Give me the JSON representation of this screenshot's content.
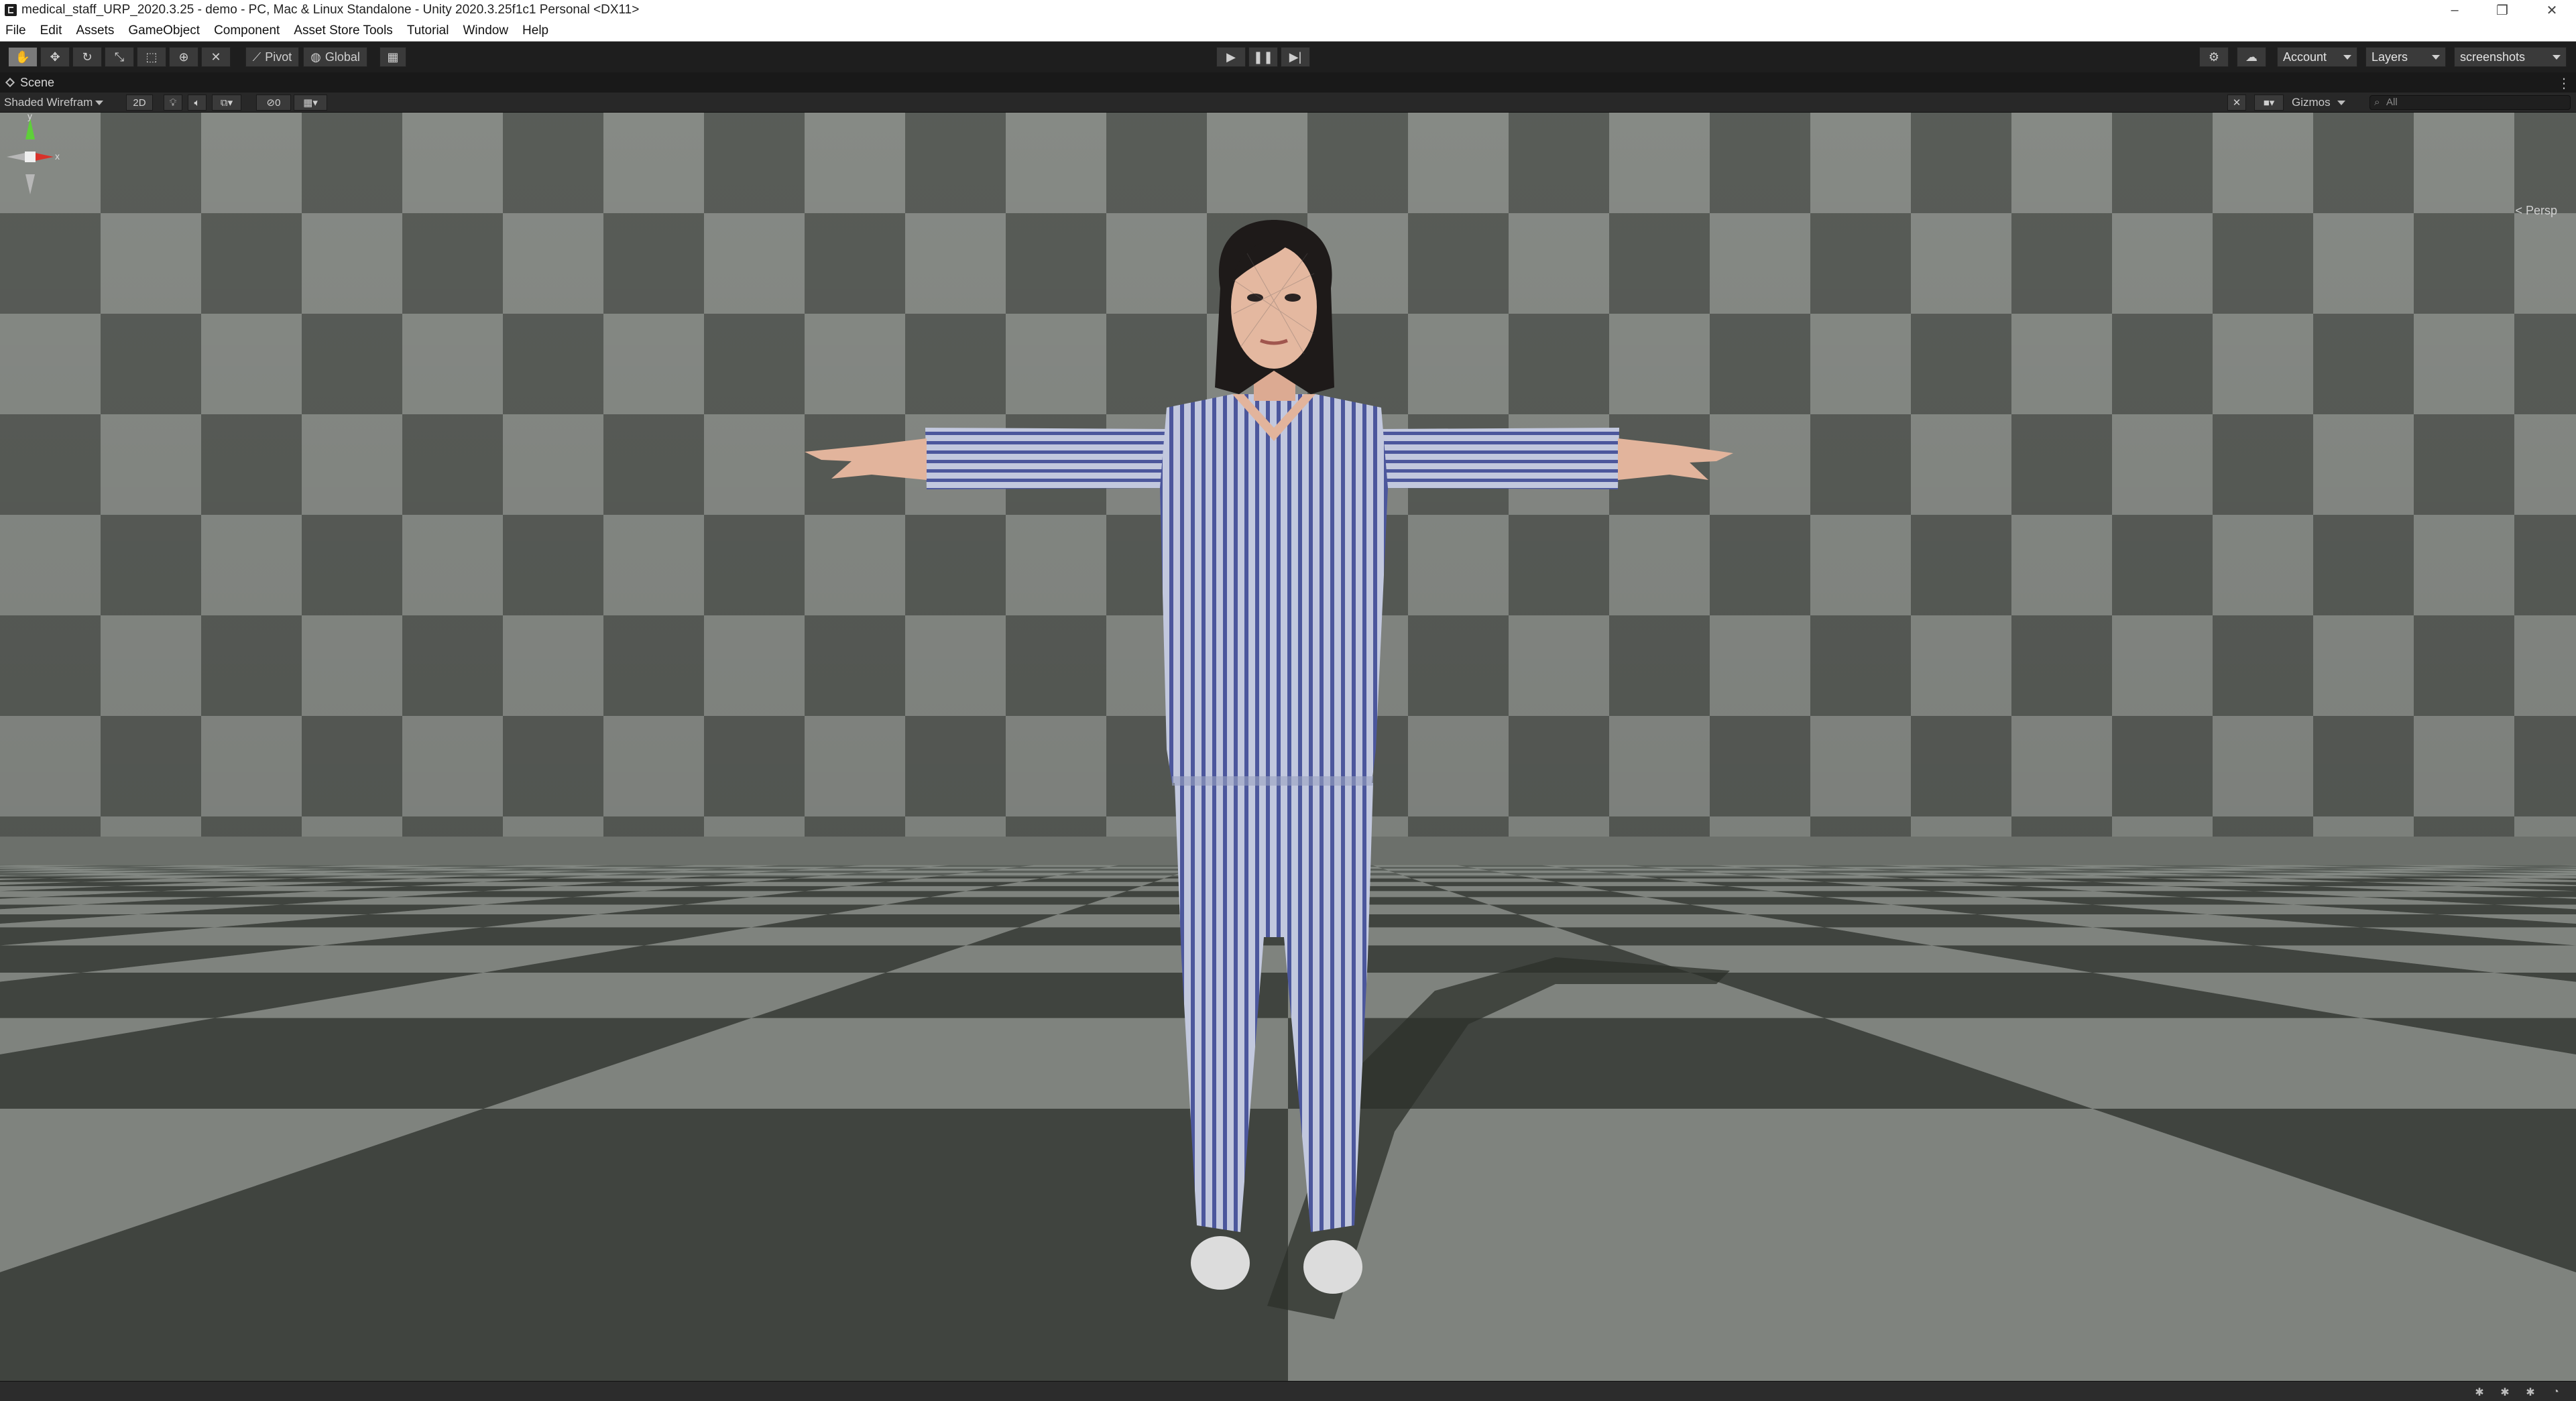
{
  "window": {
    "title": "medical_staff_URP_2020.3.25 - demo - PC, Mac & Linux Standalone - Unity 2020.3.25f1c1 Personal <DX11>",
    "minimize_glyph": "–",
    "maximize_glyph": "❐",
    "close_glyph": "✕"
  },
  "menu": [
    "File",
    "Edit",
    "Assets",
    "GameObject",
    "Component",
    "Asset Store Tools",
    "Tutorial",
    "Window",
    "Help"
  ],
  "toolbar": {
    "tools": [
      "hand-tool-icon",
      "move-tool-icon",
      "rotate-tool-icon",
      "scale-tool-icon",
      "rect-tool-icon",
      "transform-tool-icon",
      "custom-tool-icon"
    ],
    "pivot_label": "Pivot",
    "global_label": "Global",
    "account_label": "Account",
    "layers_label": "Layers",
    "layout_label": "screenshots"
  },
  "scene_tab": {
    "label": "Scene"
  },
  "scene_toolbar": {
    "draw_mode": "Shaded Wirefram",
    "mode_2d": "2D",
    "hidden_count": "0",
    "gizmos_label": "Gizmos",
    "search_placeholder": "All"
  },
  "gizmo": {
    "y_label": "y",
    "x_label": "x",
    "projection_label": "< Persp"
  },
  "colors": {
    "wall_light": "#8c908b",
    "wall_dark": "#5c605b",
    "floor_light": "#7f837e",
    "floor_dark": "#40443f",
    "pajama": "#b7bdd6",
    "stripe": "#4e5aa0",
    "skin": "#e4b8a0",
    "hair": "#1e1a19"
  }
}
